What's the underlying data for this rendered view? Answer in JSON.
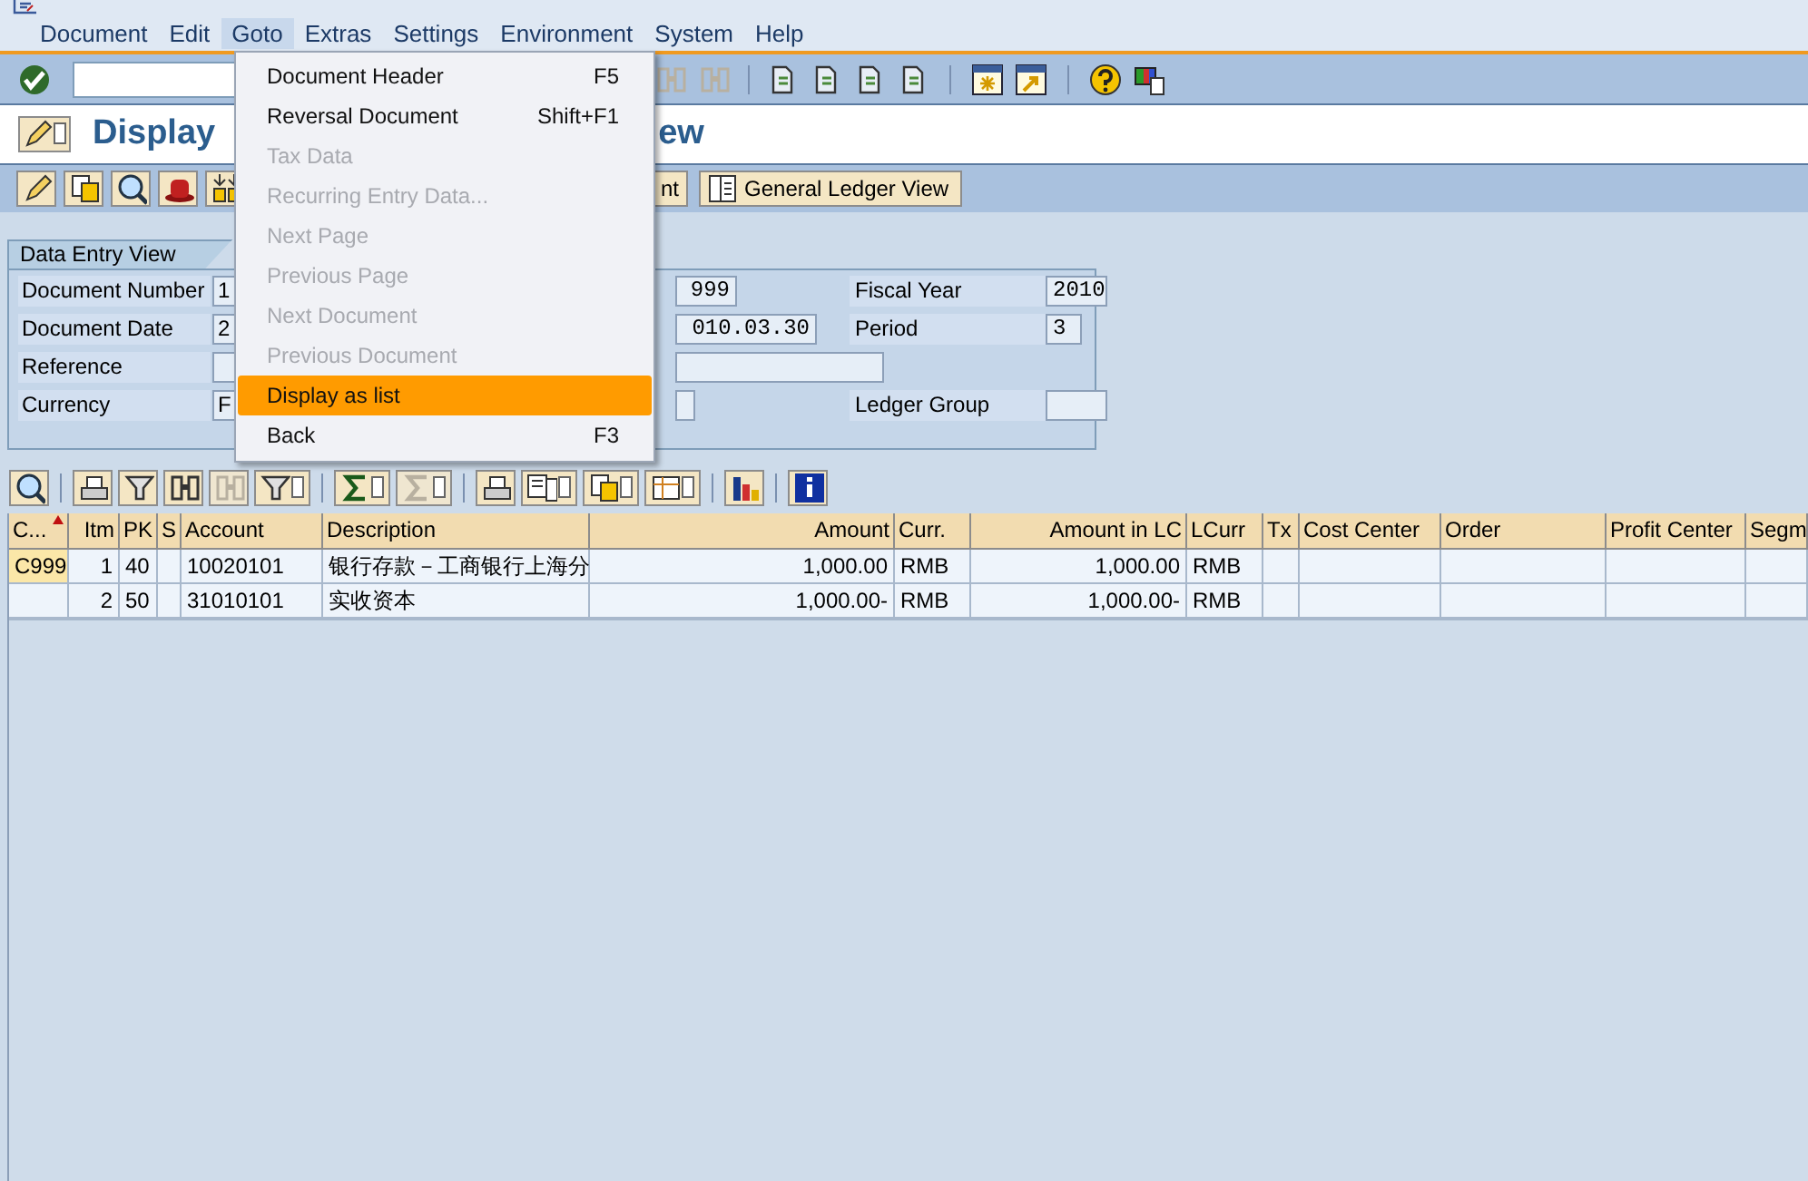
{
  "menu_bar": [
    {
      "label": "Document",
      "selected": false
    },
    {
      "label": "Edit",
      "selected": false
    },
    {
      "label": "Goto",
      "selected": true
    },
    {
      "label": "Extras",
      "selected": false
    },
    {
      "label": "Settings",
      "selected": false
    },
    {
      "label": "Environment",
      "selected": false
    },
    {
      "label": "System",
      "selected": false
    },
    {
      "label": "Help",
      "selected": false
    }
  ],
  "title_parts": [
    "Display",
    "ew"
  ],
  "app_toolbar": {
    "buttons": [
      {
        "label": "nt"
      },
      {
        "label": "General Ledger View"
      }
    ]
  },
  "form": {
    "tab": "Data Entry View",
    "left": [
      {
        "label": "Document Number",
        "value": "1"
      },
      {
        "label": "Document Date",
        "value": "2"
      },
      {
        "label": "Reference"
      },
      {
        "label": "Currency",
        "value": "F"
      }
    ],
    "middle_values": [
      "999",
      "010.03.30"
    ],
    "right": [
      {
        "kind": "field",
        "label": "Fiscal Year",
        "value": "2010"
      },
      {
        "kind": "field",
        "label": "Period",
        "value": "3"
      },
      {
        "kind": "blank"
      },
      {
        "kind": "field",
        "label": "Ledger Group"
      }
    ]
  },
  "table": {
    "columns": [
      {
        "label": "C...",
        "sorted": true
      },
      {
        "label": "Itm",
        "sorted": false
      },
      {
        "label": "PK",
        "sorted": false
      },
      {
        "label": "S",
        "sorted": false
      },
      {
        "label": "Account",
        "sorted": false
      },
      {
        "label": "Description",
        "sorted": false
      },
      {
        "label": "Amount",
        "sorted": false
      },
      {
        "label": "Curr.",
        "sorted": false
      },
      {
        "label": "Amount in LC",
        "sorted": false
      },
      {
        "label": "LCurr",
        "sorted": false
      },
      {
        "label": "Tx",
        "sorted": false
      },
      {
        "label": "Cost Center",
        "sorted": false
      },
      {
        "label": "Order",
        "sorted": false
      },
      {
        "label": "Profit Center",
        "sorted": false
      },
      {
        "label": "Segm",
        "sorted": false
      }
    ],
    "rows": [
      {
        "key_highlight": true,
        "cells": [
          "C999",
          "1",
          "40",
          "",
          "10020101",
          "银行存款－工商银行上海分",
          "1,000.00",
          "RMB",
          "1,000.00",
          "RMB",
          "",
          "",
          "",
          "",
          ""
        ]
      },
      {
        "key_highlight": false,
        "cells": [
          "",
          "2",
          "50",
          "",
          "31010101",
          "实收资本",
          "1,000.00-",
          "RMB",
          "1,000.00-",
          "RMB",
          "",
          "",
          "",
          "",
          ""
        ]
      }
    ]
  },
  "goto_menu": [
    {
      "label": "Document Header",
      "shortcut": "F5",
      "disabled": false,
      "selected": false
    },
    {
      "label": "Reversal Document",
      "shortcut": "Shift+F1",
      "disabled": false,
      "selected": false
    },
    {
      "label": "Tax Data",
      "disabled": true,
      "selected": false
    },
    {
      "label": "Recurring Entry Data...",
      "disabled": true,
      "selected": false
    },
    {
      "label": "Next Page",
      "disabled": true,
      "selected": false
    },
    {
      "label": "Previous Page",
      "disabled": true,
      "selected": false
    },
    {
      "label": "Next Document",
      "disabled": true,
      "selected": false
    },
    {
      "label": "Previous Document",
      "disabled": true,
      "selected": false
    },
    {
      "label": "Display as list",
      "disabled": false,
      "selected": true
    },
    {
      "label": "Back",
      "shortcut": "F3",
      "disabled": false,
      "selected": false
    }
  ]
}
